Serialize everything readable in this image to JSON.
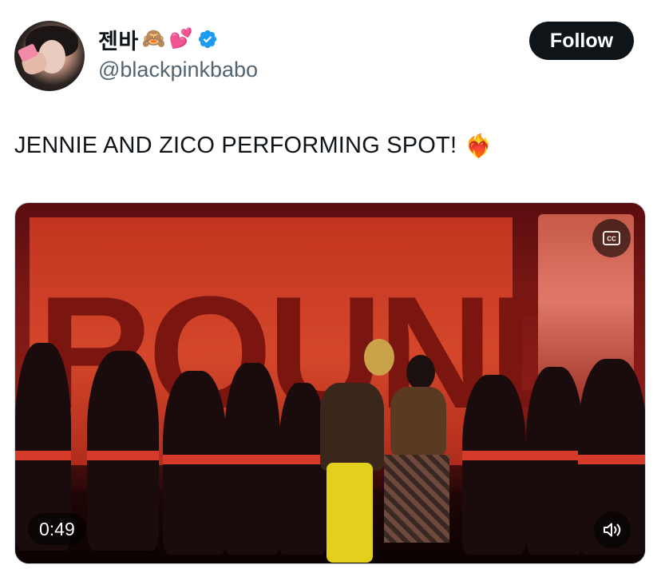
{
  "author": {
    "display_name": "젠바",
    "display_emojis": [
      "🙈",
      "💕"
    ],
    "handle": "@blackpinkbabo",
    "verified": true,
    "verified_color": "#1d9bf0",
    "avatar_icon": "profile-photo"
  },
  "actions": {
    "follow_label": "Follow"
  },
  "tweet": {
    "text": "JENNIE AND ZICO PERFORMING SPOT!",
    "emoji": "❤️‍🔥"
  },
  "media": {
    "type": "video",
    "duration": "0:49",
    "captions_icon": "closed-captions-icon",
    "volume_icon": "speaker-muted-icon",
    "backdrop_text": "ROUND"
  },
  "colors": {
    "text_primary": "#0f1419",
    "text_secondary": "#536471",
    "follow_bg": "#0f1419",
    "follow_text": "#ffffff"
  }
}
